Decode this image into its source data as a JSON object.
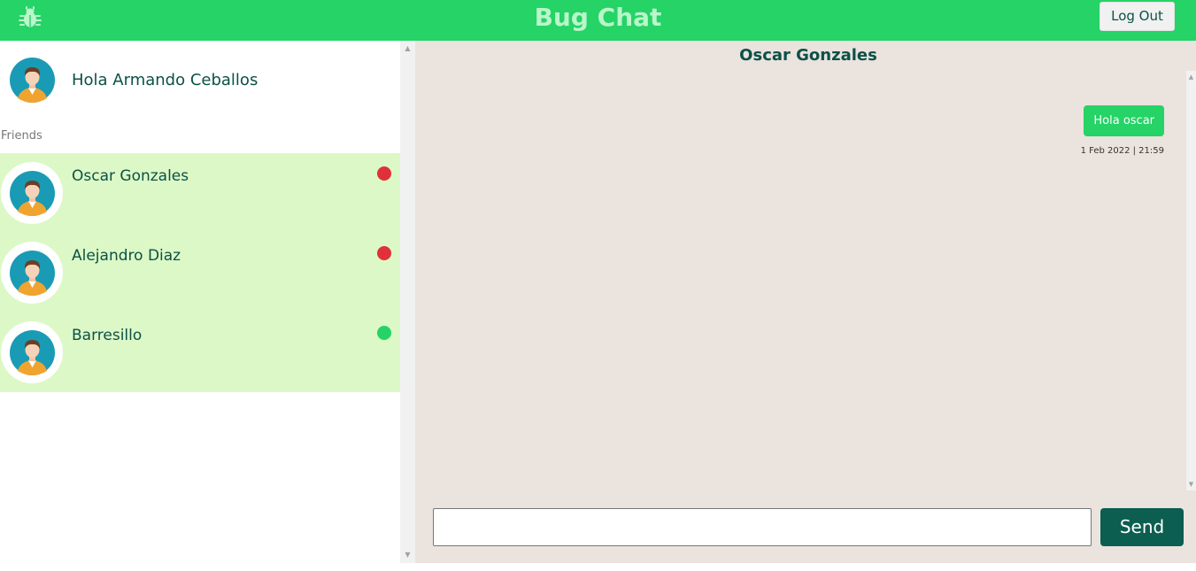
{
  "header": {
    "title": "Bug Chat",
    "logout_label": "Log Out",
    "logo_icon": "bug-icon",
    "color": "#25d366"
  },
  "sidebar": {
    "greeting": "Hola Armando Ceballos",
    "friends_label": "Friends",
    "friends": [
      {
        "name": "Oscar Gonzales",
        "status": "offline",
        "status_color": "#e0313a"
      },
      {
        "name": "Alejandro Diaz",
        "status": "offline",
        "status_color": "#e0313a"
      },
      {
        "name": "Barresillo",
        "status": "online",
        "status_color": "#25d366"
      }
    ]
  },
  "chat": {
    "title": "Oscar Gonzales",
    "messages": [
      {
        "text": "Hola oscar",
        "time": "1 Feb 2022 | 21:59",
        "sent": true
      }
    ],
    "input_value": "",
    "send_label": "Send"
  },
  "colors": {
    "header": "#25d366",
    "accent_dark": "#0b5e50",
    "friends_bg": "#dcf8c6",
    "chat_bg": "#ebe3de"
  }
}
